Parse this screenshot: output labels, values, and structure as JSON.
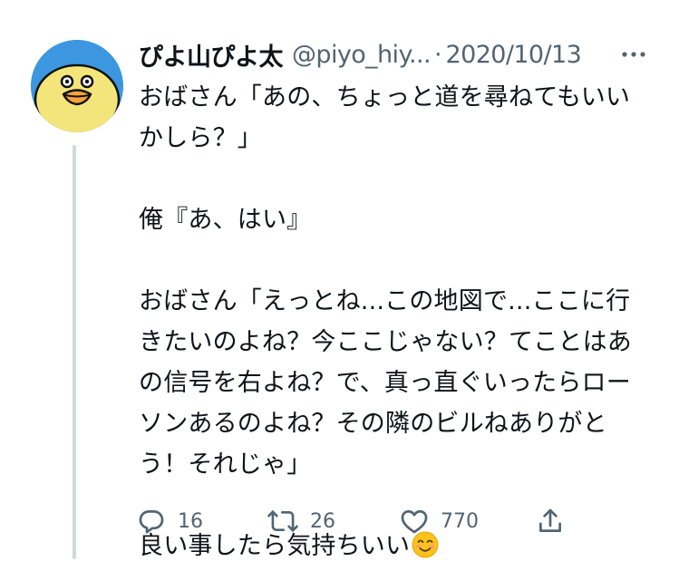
{
  "colors": {
    "avatar_bg": "#3d97e0",
    "avatar_face": "#f3e57a",
    "text_primary": "#0f1419",
    "text_secondary": "#536471",
    "thread_line": "#cfd9de"
  },
  "tweet": {
    "display_name": "ぴよ山ぴよ太",
    "handle": "@piyo_hiy...",
    "separator": "·",
    "date": "2020/10/13",
    "more_icon": "more-horizontal-icon",
    "body": "おばさん「あの、ちょっと道を尋ねてもいい\nかしら？」\n\n俺『あ、はい』\n\nおばさん「えっとね...この地図で...ここに行\nきたいのよね？今ここじゃない？てことはあ\nの信号を右よね？で、真っ直ぐいったらロー\nソンあるのよね？その隣のビルねありがと\nう！それじゃ」\n\n良い事したら気持ちいい",
    "emoji": "smiling-face-emoji"
  },
  "actions": {
    "reply_count": "16",
    "retweet_count": "26",
    "like_count": "770",
    "icons": [
      "reply-icon",
      "retweet-icon",
      "like-icon",
      "share-icon"
    ]
  }
}
